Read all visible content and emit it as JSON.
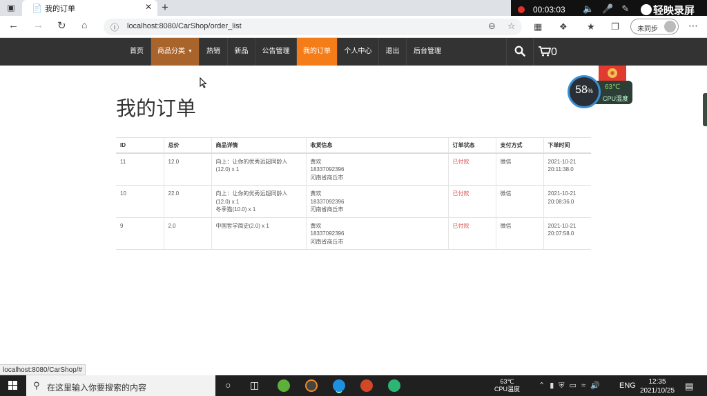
{
  "browser": {
    "tab_title": "我的订单",
    "url": "localhost:8080/CarShop/order_list",
    "sync_label": "未同步",
    "status_link": "localhost:8080/CarShop/#"
  },
  "recorder": {
    "time": "00:03:03",
    "brand": "轻映录屏"
  },
  "nav": {
    "items": [
      "首页",
      "商品分类",
      "热销",
      "新品",
      "公告管理",
      "我的订单",
      "个人中心",
      "退出",
      "后台管理"
    ],
    "cart_count": "0",
    "colors": {
      "bar": "#333333",
      "category": "#a9642c",
      "active": "#f57d19"
    }
  },
  "cpu": {
    "usage": "58",
    "usage_unit": "%",
    "temp": "63℃",
    "label": "CPU温度"
  },
  "page": {
    "title": "我的订单"
  },
  "orders": {
    "headers": [
      "ID",
      "总价",
      "商品详情",
      "收货信息",
      "订单状态",
      "支付方式",
      "下单时间"
    ],
    "rows": [
      {
        "id": "11",
        "total": "12.0",
        "items": [
          "向上：让你的优秀远超同龄人(12.0) x 1"
        ],
        "name": "黄欢",
        "phone": "18337092396",
        "address": "河南省商丘市",
        "status": "已付款",
        "payment": "微信",
        "date": "2021-10-21",
        "time": "20:11:38.0"
      },
      {
        "id": "10",
        "total": "22.0",
        "items": [
          "向上：让你的优秀远超同龄人(12.0) x 1",
          "冬季猫(10.0) x 1"
        ],
        "name": "黄欢",
        "phone": "18337092396",
        "address": "河南省商丘市",
        "status": "已付款",
        "payment": "微信",
        "date": "2021-10-21",
        "time": "20:08:36.0"
      },
      {
        "id": "9",
        "total": "2.0",
        "items": [
          "中国哲学简史(2.0) x 1"
        ],
        "name": "黄欢",
        "phone": "18337092396",
        "address": "河南省商丘市",
        "status": "已付款",
        "payment": "微信",
        "date": "2021-10-21",
        "time": "20:07:58.0"
      }
    ]
  },
  "taskbar": {
    "search_placeholder": "在这里输入你要搜索的内容",
    "temp": "63℃",
    "temp_label": "CPU温度",
    "lang": "ENG",
    "clock_time": "12:35",
    "clock_date": "2021/10/25"
  }
}
